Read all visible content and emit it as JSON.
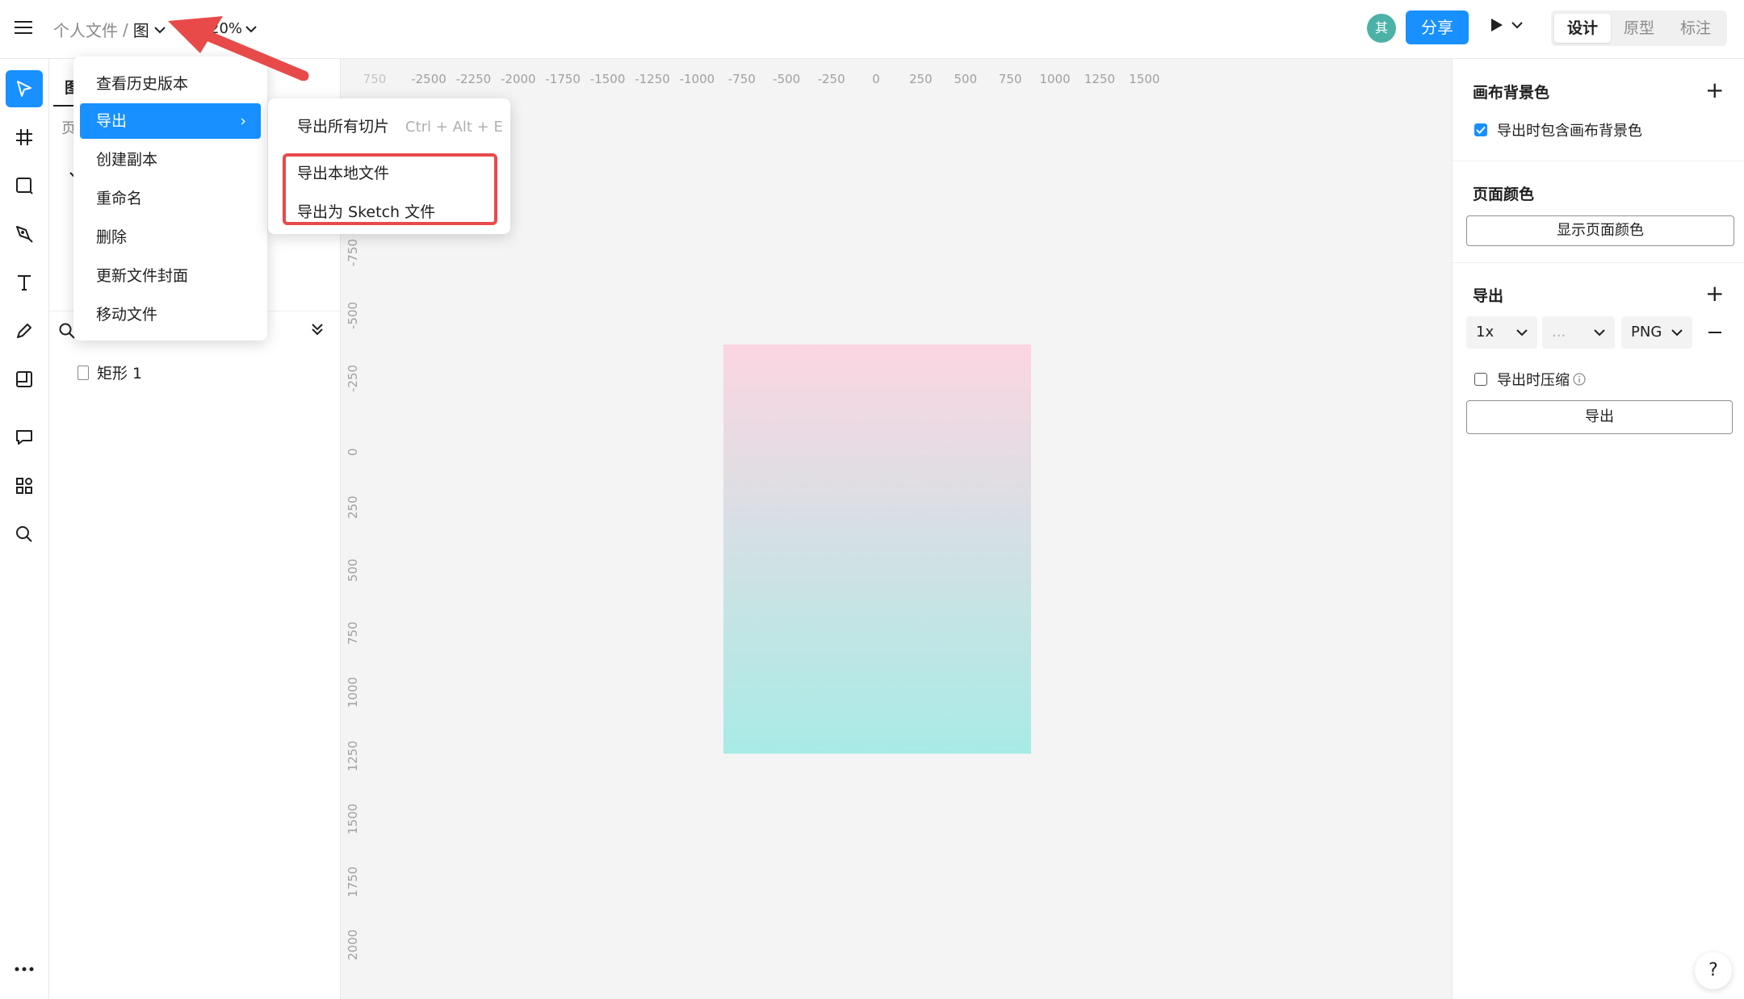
{
  "header": {
    "breadcrumb_root": "个人文件",
    "breadcrumb_sep": "/",
    "breadcrumb_current": "图",
    "zoom": "20%",
    "avatar_initial": "其",
    "share_label": "分享",
    "tabs": [
      "设计",
      "原型",
      "标注"
    ],
    "active_tab": "设计"
  },
  "layers_panel": {
    "tab_label_partial": "图",
    "page_label_partial": "页",
    "layer_name": "矩形 1"
  },
  "file_menu": {
    "items": [
      "查看历史版本",
      "导出",
      "创建副本",
      "重命名",
      "删除",
      "更新文件封面",
      "移动文件"
    ],
    "active_item": "导出",
    "submenu_arrow": "›"
  },
  "export_submenu": {
    "items": [
      {
        "label": "导出所有切片",
        "shortcut": "Ctrl + Alt + E"
      },
      {
        "label": "导出本地文件",
        "shortcut": ""
      },
      {
        "label": "导出为 Sketch 文件",
        "shortcut": ""
      }
    ]
  },
  "ruler": {
    "horizontal": [
      "-2500",
      "-2250",
      "-2000",
      "-1750",
      "-1500",
      "-1250",
      "-1000",
      "-750",
      "-500",
      "-250",
      "0",
      "250",
      "500",
      "750",
      "1000",
      "1250",
      "1500"
    ],
    "vertical": [
      "-750",
      "-500",
      "-250",
      "0",
      "250",
      "500",
      "750",
      "1000",
      "1250",
      "1500",
      "1750",
      "2000"
    ]
  },
  "right_panel": {
    "canvas_bg_title": "画布背景色",
    "include_bg_label": "导出时包含画布背景色",
    "include_bg_checked": true,
    "page_color_title": "页面颜色",
    "show_page_color_button": "显示页面颜色",
    "export_title": "导出",
    "scale": "1x",
    "suffix_placeholder": "...",
    "format": "PNG",
    "compress_label": "导出时压缩",
    "compress_checked": false,
    "export_button": "导出"
  },
  "help_label": "?",
  "colors": {
    "accent": "#1890ff",
    "highlight": "#e84a4a",
    "gradient_top": "#fcd6e2",
    "gradient_bottom": "#a8ebe6"
  }
}
